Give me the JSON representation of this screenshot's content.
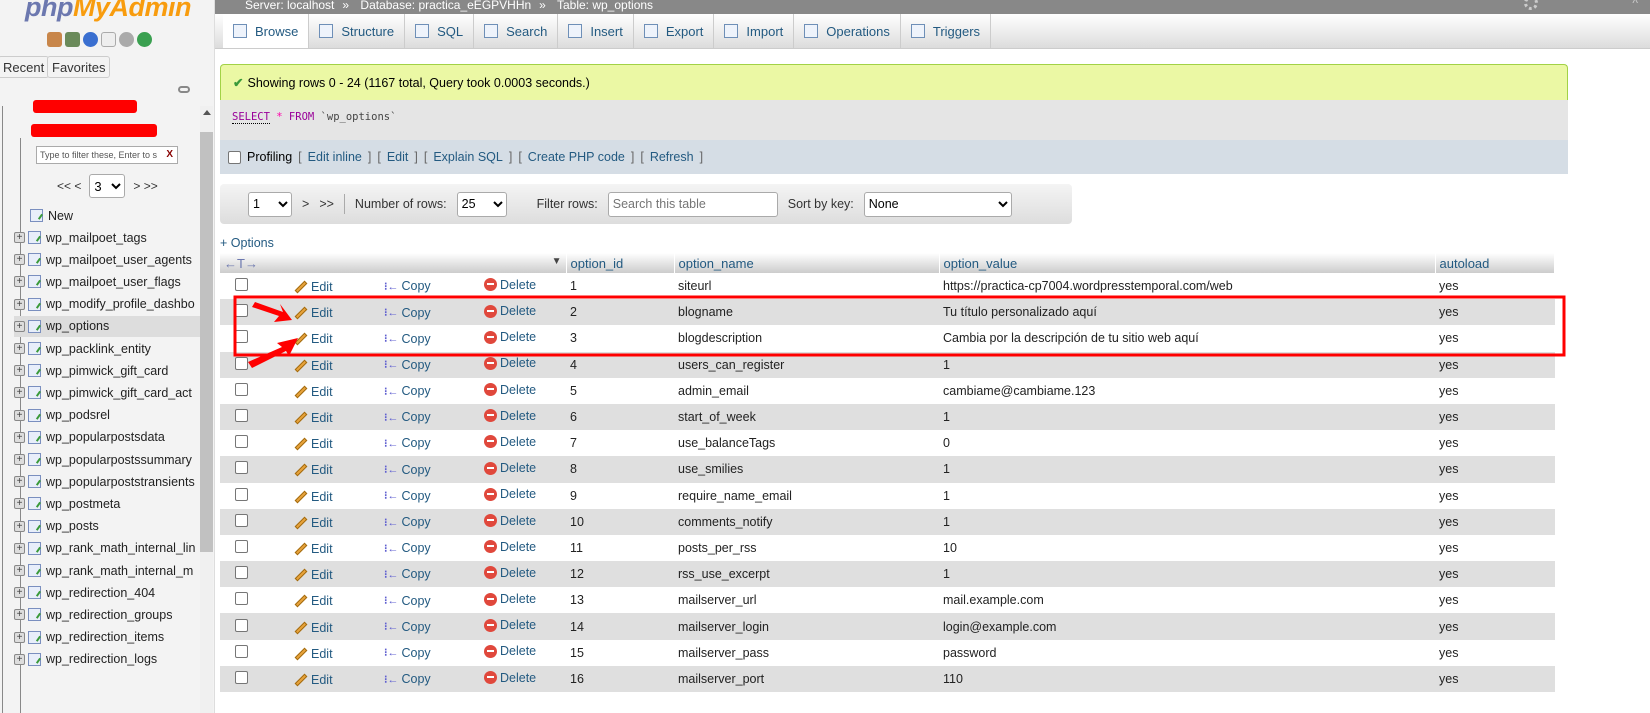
{
  "sidebar": {
    "logo_php": "php",
    "logo_myadmin": "MyAdmin",
    "recent_label": "Recent",
    "favorites_label": "Favorites",
    "filter_placeholder": "Type to filter these, Enter to s",
    "filter_clear": "X",
    "pager_first": "<< <",
    "pager_next": "> >>",
    "pager_value": "3",
    "new_label": "New",
    "tables": [
      "wp_mailpoet_tags",
      "wp_mailpoet_user_agents",
      "wp_mailpoet_user_flags",
      "wp_modify_profile_dashbo",
      "wp_options",
      "wp_packlink_entity",
      "wp_pimwick_gift_card",
      "wp_pimwick_gift_card_act",
      "wp_podsrel",
      "wp_popularpostsdata",
      "wp_popularpostssummary",
      "wp_popularpoststransients",
      "wp_postmeta",
      "wp_posts",
      "wp_rank_math_internal_lin",
      "wp_rank_math_internal_m",
      "wp_redirection_404",
      "wp_redirection_groups",
      "wp_redirection_items",
      "wp_redirection_logs"
    ],
    "active_table": "wp_options"
  },
  "breadcrumb": {
    "server": "Server: localhost",
    "database": "Database: practica_eEGPVHHn",
    "table": "Table: wp_options",
    "sep": "»"
  },
  "tabs": [
    {
      "label": "Browse",
      "icon": "browse-icon"
    },
    {
      "label": "Structure",
      "icon": "structure-icon"
    },
    {
      "label": "SQL",
      "icon": "sql-icon"
    },
    {
      "label": "Search",
      "icon": "search-icon"
    },
    {
      "label": "Insert",
      "icon": "insert-icon"
    },
    {
      "label": "Export",
      "icon": "export-icon"
    },
    {
      "label": "Import",
      "icon": "import-icon"
    },
    {
      "label": "Operations",
      "icon": "wrench-icon"
    },
    {
      "label": "Triggers",
      "icon": "triggers-icon"
    }
  ],
  "message": "Showing rows 0 - 24 (1167 total, Query took 0.0003 seconds.)",
  "sql": {
    "select": "SELECT",
    "star": "*",
    "from": "FROM",
    "table": "`wp_options`"
  },
  "profiling": {
    "label": "Profiling",
    "links": [
      "Edit inline",
      "Edit",
      "Explain SQL",
      "Create PHP code",
      "Refresh"
    ]
  },
  "nav": {
    "page": "1",
    "next": ">",
    "last": ">>",
    "rows_label": "Number of rows:",
    "rows_value": "25",
    "filter_label": "Filter rows:",
    "filter_placeholder": "Search this table",
    "sort_label": "Sort by key:",
    "sort_value": "None"
  },
  "options_link": "+ Options",
  "actions": {
    "edit": "Edit",
    "copy": "Copy",
    "delete": "Delete"
  },
  "columns": [
    "option_id",
    "option_name",
    "option_value",
    "autoload"
  ],
  "rows": [
    [
      "1",
      "siteurl",
      "https://practica-cp7004.wordpresstemporal.com/web",
      "yes"
    ],
    [
      "2",
      "blogname",
      "Tu título personalizado aquí",
      "yes"
    ],
    [
      "3",
      "blogdescription",
      "Cambia por la descripción de tu sitio web aquí",
      "yes"
    ],
    [
      "4",
      "users_can_register",
      "1",
      "yes"
    ],
    [
      "5",
      "admin_email",
      "cambiame@cambiame.123",
      "yes"
    ],
    [
      "6",
      "start_of_week",
      "1",
      "yes"
    ],
    [
      "7",
      "use_balanceTags",
      "0",
      "yes"
    ],
    [
      "8",
      "use_smilies",
      "1",
      "yes"
    ],
    [
      "9",
      "require_name_email",
      "1",
      "yes"
    ],
    [
      "10",
      "comments_notify",
      "1",
      "yes"
    ],
    [
      "11",
      "posts_per_rss",
      "10",
      "yes"
    ],
    [
      "12",
      "rss_use_excerpt",
      "1",
      "yes"
    ],
    [
      "13",
      "mailserver_url",
      "mail.example.com",
      "yes"
    ],
    [
      "14",
      "mailserver_login",
      "login@example.com",
      "yes"
    ],
    [
      "15",
      "mailserver_pass",
      "password",
      "yes"
    ],
    [
      "16",
      "mailserver_port",
      "110",
      "yes"
    ]
  ],
  "colors": {
    "annotation": "#ff0000",
    "success_bg": "#ebf8a4",
    "link": "#235a81"
  }
}
